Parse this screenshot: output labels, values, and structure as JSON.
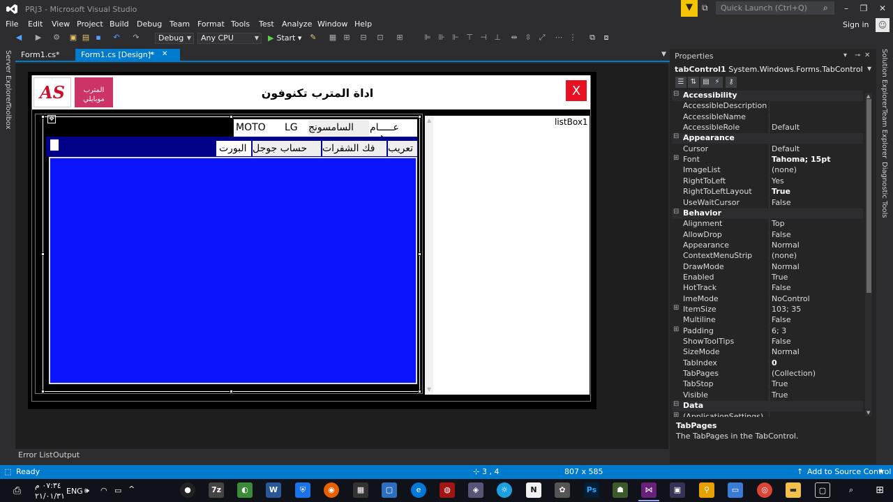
{
  "window": {
    "title": "PRJ3 - Microsoft Visual Studio",
    "quick_launch_placeholder": "Quick Launch (Ctrl+Q)",
    "sign_in": "Sign in",
    "minimize": "–",
    "maximize": "❐",
    "close": "✕"
  },
  "menu": [
    "File",
    "Edit",
    "View",
    "Project",
    "Build",
    "Debug",
    "Team",
    "Format",
    "Tools",
    "Test",
    "Analyze",
    "Window",
    "Help"
  ],
  "toolbar": {
    "config": "Debug",
    "platform": "Any CPU",
    "start": "Start"
  },
  "left_strip": [
    "Server Explorer",
    "Toolbox"
  ],
  "doc_tabs": [
    {
      "label": "Form1.cs*"
    },
    {
      "label": "Form1.cs [Design]*",
      "pin": "⊸",
      "close": "✕"
    }
  ],
  "form": {
    "logo_text": "AS",
    "brand_line1": "المترب",
    "brand_line2": "موبايلي",
    "title": "اداة المترب تكنوفون",
    "close_label": "X",
    "outer_tabs": [
      "عـــــام",
      "السامسونج",
      "LG",
      "MOTO"
    ],
    "inner_tabs": [
      "تعريب",
      "فك الشفرات",
      "حساب جوجل",
      "البورت"
    ],
    "listbox_label": "listBox1"
  },
  "bottom_tabs": [
    "Error List",
    "Output"
  ],
  "properties": {
    "title": "Properties",
    "object_name": "tabControl1",
    "object_type": "System.Windows.Forms.TabControl",
    "rows": [
      {
        "type": "cat",
        "name": "Accessibility"
      },
      {
        "name": "AccessibleDescription",
        "value": ""
      },
      {
        "name": "AccessibleName",
        "value": ""
      },
      {
        "name": "AccessibleRole",
        "value": "Default"
      },
      {
        "type": "cat",
        "name": "Appearance"
      },
      {
        "name": "Cursor",
        "value": "Default"
      },
      {
        "name": "Font",
        "value": "Tahoma; 15pt",
        "bold": true,
        "expand": true
      },
      {
        "name": "ImageList",
        "value": "(none)"
      },
      {
        "name": "RightToLeft",
        "value": "Yes"
      },
      {
        "name": "RightToLeftLayout",
        "value": "True",
        "bold": true
      },
      {
        "name": "UseWaitCursor",
        "value": "False"
      },
      {
        "type": "cat",
        "name": "Behavior"
      },
      {
        "name": "Alignment",
        "value": "Top"
      },
      {
        "name": "AllowDrop",
        "value": "False"
      },
      {
        "name": "Appearance",
        "value": "Normal"
      },
      {
        "name": "ContextMenuStrip",
        "value": "(none)"
      },
      {
        "name": "DrawMode",
        "value": "Normal"
      },
      {
        "name": "Enabled",
        "value": "True"
      },
      {
        "name": "HotTrack",
        "value": "False"
      },
      {
        "name": "ImeMode",
        "value": "NoControl"
      },
      {
        "name": "ItemSize",
        "value": "103; 35",
        "expand": true
      },
      {
        "name": "Multiline",
        "value": "False"
      },
      {
        "name": "Padding",
        "value": "6; 3",
        "expand": true
      },
      {
        "name": "ShowToolTips",
        "value": "False"
      },
      {
        "name": "SizeMode",
        "value": "Normal"
      },
      {
        "name": "TabIndex",
        "value": "0",
        "bold": true
      },
      {
        "name": "TabPages",
        "value": "(Collection)"
      },
      {
        "name": "TabStop",
        "value": "True"
      },
      {
        "name": "Visible",
        "value": "True"
      },
      {
        "type": "cat",
        "name": "Data"
      },
      {
        "name": "(ApplicationSettings)",
        "value": "",
        "expand": true
      }
    ],
    "desc_title": "TabPages",
    "desc_text": "The TabPages in the TabControl."
  },
  "right_strip": [
    "Solution Explorer",
    "Team Explorer",
    "Diagnostic Tools"
  ],
  "status": {
    "ready": "Ready",
    "position": "3 , 4",
    "size": "807 x 585",
    "source_control": "Add to Source Control"
  },
  "taskbar": {
    "lang": "ENG",
    "time": "٠٧:٣٤ م",
    "date": "٢١/٠١/٣١"
  }
}
